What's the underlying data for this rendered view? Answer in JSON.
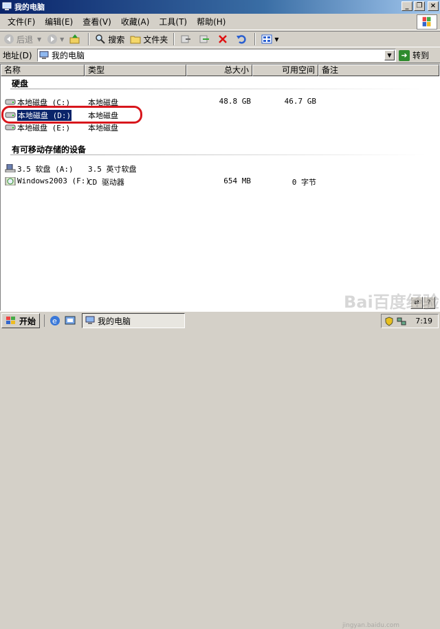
{
  "window": {
    "title": "我的电脑"
  },
  "menu": [
    {
      "label": "文件(F)"
    },
    {
      "label": "编辑(E)"
    },
    {
      "label": "查看(V)"
    },
    {
      "label": "收藏(A)"
    },
    {
      "label": "工具(T)"
    },
    {
      "label": "帮助(H)"
    }
  ],
  "toolbar": {
    "back": "后退",
    "search": "搜索",
    "folders": "文件夹"
  },
  "address": {
    "label": "地址(D)",
    "value": "我的电脑",
    "go": "转到"
  },
  "columns": [
    "名称",
    "类型",
    "总大小",
    "可用空间",
    "备注"
  ],
  "groups": {
    "hard_disks": "硬盘",
    "removable": "有可移动存储的设备"
  },
  "drives": [
    {
      "name": "本地磁盘 (C:)",
      "type": "本地磁盘",
      "size": "48.8 GB",
      "free": "46.7 GB"
    },
    {
      "name": "本地磁盘 (D:)",
      "type": "本地磁盘",
      "size": "",
      "free": ""
    },
    {
      "name": "本地磁盘 (E:)",
      "type": "本地磁盘",
      "size": "",
      "free": ""
    }
  ],
  "removable": [
    {
      "name": "3.5 软盘 (A:)",
      "type": "3.5 英寸软盘",
      "size": "",
      "free": ""
    },
    {
      "name": "Windows2003 (F:)",
      "type": "CD 驱动器",
      "size": "654 MB",
      "free": "0 字节"
    }
  ],
  "taskbar": {
    "start": "开始",
    "task": "我的电脑",
    "clock": "7:19"
  },
  "watermark": {
    "brand": "Bai百度经验",
    "url": "jingyan.baidu.com"
  },
  "colors": {
    "title_start": "#0a246a",
    "title_end": "#a6caf0",
    "selection": "#0a246a",
    "highlight_mark": "#d8161c"
  }
}
